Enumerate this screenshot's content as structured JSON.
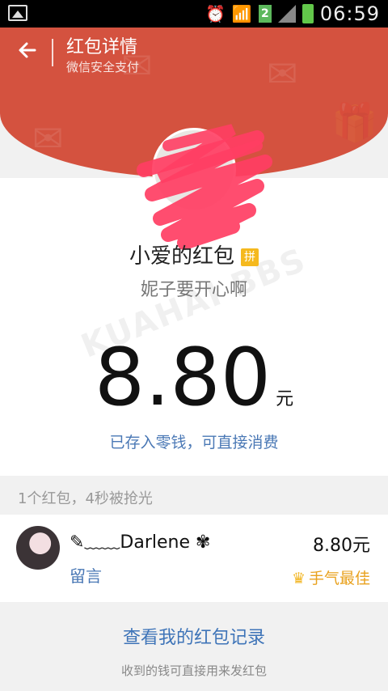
{
  "status_bar": {
    "sim_slot": "2",
    "time": "06:59"
  },
  "header": {
    "title": "红包详情",
    "subtitle": "微信安全支付"
  },
  "packet": {
    "sender": "小爱的红包",
    "pin_badge": "拼",
    "greeting": "妮子要开心啊",
    "amount": "8.80",
    "unit": "元",
    "status": "已存入零钱，可直接消费"
  },
  "watermark": "KUAHAI BBS",
  "summary": "1个红包，4秒被抢光",
  "receivers": [
    {
      "name": "✎﹏﹏Darlene ✾",
      "amount": "8.80元",
      "note_label": "留言",
      "best_label": "手气最佳"
    }
  ],
  "footer": {
    "records_link": "查看我的红包记录",
    "note": "收到的钱可直接用来发红包"
  },
  "colors": {
    "header_red": "#d4523f",
    "link_blue": "#3e74b8",
    "best_gold": "#e9a21f"
  }
}
